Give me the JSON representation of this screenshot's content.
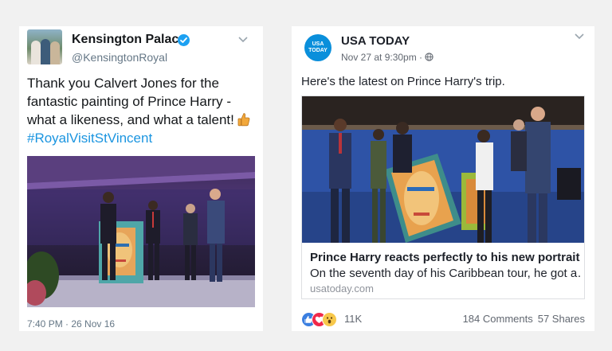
{
  "tweet": {
    "display_name": "Kensington Palace",
    "handle": "@KensingtonRoyal",
    "text_lines": [
      "Thank you Calvert Jones for the",
      "fantastic painting of Prince Harry -",
      "what a likeness, and what a talent!"
    ],
    "hashtag": "#RoyalVisitStVincent",
    "emoji": "thumbs-up",
    "timestamp": "7:40 PM · 26 Nov 16",
    "verified_color": "#1da1f2",
    "hashtag_color": "#1b95e0"
  },
  "facebook_post": {
    "avatar_text": "USA TODAY",
    "page_name": "USA TODAY",
    "meta": "Nov 27 at 9:30pm ·",
    "privacy_icon": "globe-icon",
    "text": "Here's the latest on Prince Harry's trip.",
    "link": {
      "title": "Prince Harry reacts perfectly to his new portrait",
      "description": "On the seventh day of his Caribbean tour, he got a…",
      "domain": "usatoday.com"
    },
    "reactions": [
      "like",
      "love",
      "wow"
    ],
    "reaction_count": "11K",
    "comments": "184 Comments",
    "shares": "57 Shares",
    "brand_color": "#0a8fdb"
  }
}
